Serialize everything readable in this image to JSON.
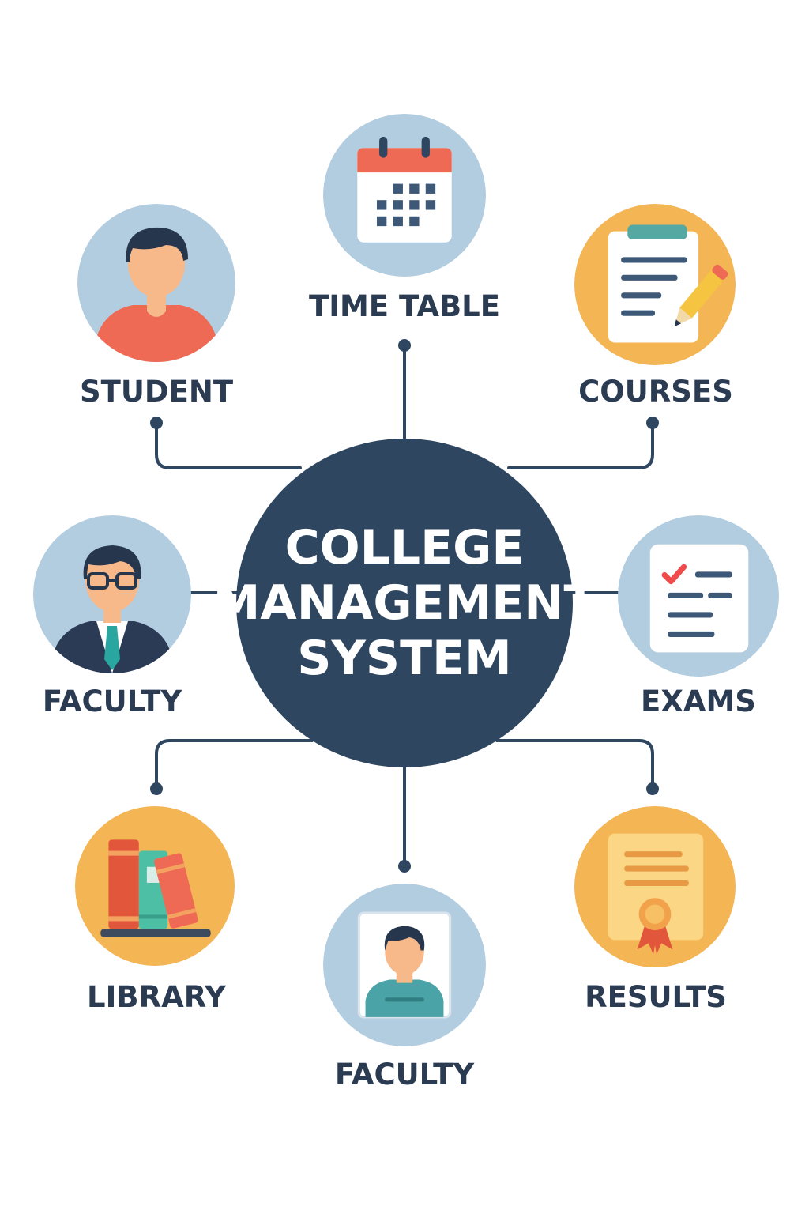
{
  "diagram": {
    "hub": {
      "title": "COLLEGE\nMANAGEMENT\nSYSTEM"
    },
    "modules": [
      {
        "label": "TIME TABLE",
        "icon": "calendar-icon"
      },
      {
        "label": "STUDENT",
        "icon": "student-icon"
      },
      {
        "label": "COURSES",
        "icon": "clipboard-pencil-icon"
      },
      {
        "label": "FACULTY",
        "icon": "teacher-icon"
      },
      {
        "label": "EXAMS",
        "icon": "checklist-icon"
      },
      {
        "label": "LIBRARY",
        "icon": "books-icon"
      },
      {
        "label": "FACULTY",
        "icon": "id-card-icon"
      },
      {
        "label": "RESULTS",
        "icon": "certificate-icon"
      }
    ]
  },
  "colors": {
    "hub": "#2f4660",
    "connector": "#2f4660",
    "label": "#2b3b52",
    "circle_blue": "#b3cde0",
    "circle_orange": "#f4b555"
  }
}
